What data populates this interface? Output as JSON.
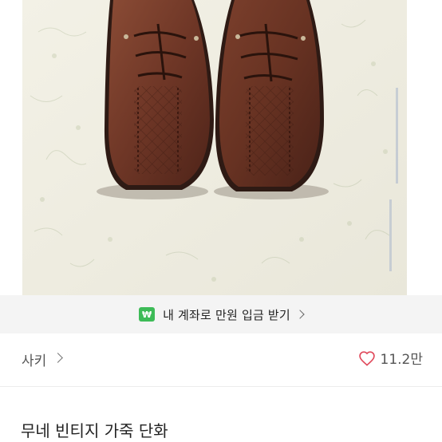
{
  "promo": {
    "icon": "won-wallet-icon",
    "icon_glyph": "₩",
    "text": "내 계좌로 만원 입금 받기",
    "accent": "#3dbb57"
  },
  "shop": {
    "name": "사키"
  },
  "like": {
    "icon": "heart-icon",
    "count": "11.2만",
    "color": "#e0485a"
  },
  "product": {
    "title": "무네 빈티지 가죽 단화"
  }
}
